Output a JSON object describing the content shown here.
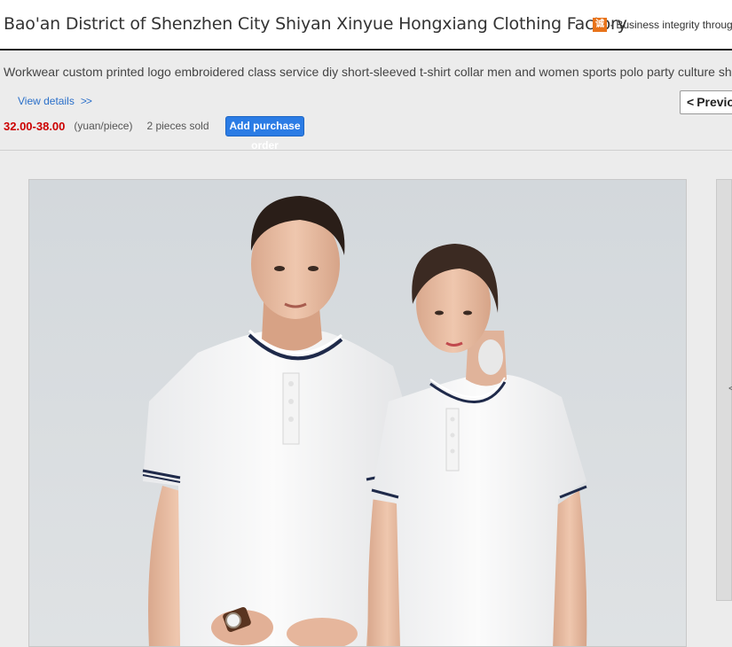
{
  "header": {
    "shop_name": "Bao'an District of Shenzhen City Shiyan Xinyue Hongxiang Clothing Factory",
    "integrity_icon": "integrity-badge-icon",
    "integrity_icon_text": "诚",
    "integrity_text": "· Business integrity through"
  },
  "product": {
    "title": "Workwear custom printed logo embroidered class service diy short-sleeved t-shirt collar men and women sports polo party culture shirt",
    "view_details": "View details",
    "view_details_chevron": ">>",
    "price": "32.00-38.00",
    "unit": "(yuan/piece)",
    "sold": "2  pieces sold",
    "add_button_line1": "Add purchase",
    "add_button_line2": "order"
  },
  "nav": {
    "prev_label": "Previous",
    "prev_arrow": "<",
    "side_arrow": "<"
  },
  "colors": {
    "accent_blue": "#2b7ce5",
    "price_red": "#cc0000",
    "badge_orange": "#e8731a"
  }
}
